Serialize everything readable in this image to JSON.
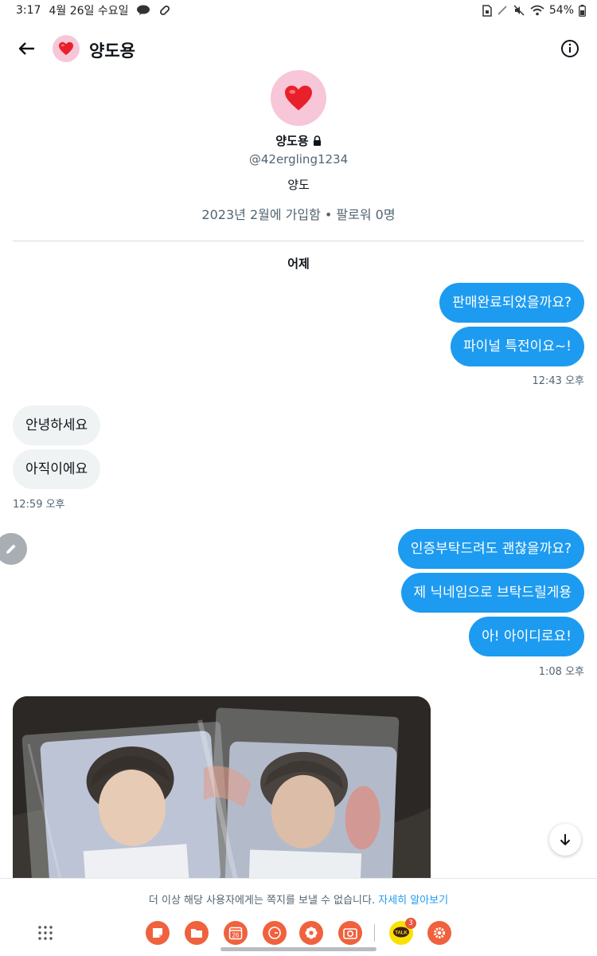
{
  "status_bar": {
    "time": "3:17",
    "date": "4월 26일 수요일",
    "battery": "54%",
    "icons": [
      "talk-icon",
      "pill-icon",
      "sim-icon",
      "no-signal-icon",
      "mute-icon",
      "wifi-icon",
      "battery-icon"
    ]
  },
  "header": {
    "title": "양도용"
  },
  "profile": {
    "name": "양도용",
    "handle": "@42ergling1234",
    "bio": "양도",
    "meta": "2023년 2월에 가입함 • 팔로워 0명"
  },
  "day_label": "어제",
  "messages": [
    {
      "side": "out",
      "text": "판매완료되었을까요?"
    },
    {
      "side": "out",
      "text": "파이널 특전이요~!"
    },
    {
      "side": "in",
      "text": "안녕하세요"
    },
    {
      "side": "in",
      "text": "아직이에요"
    },
    {
      "side": "out",
      "text": "인증부탁드려도 괜찮을까요?"
    },
    {
      "side": "out",
      "text": "제 닉네임으로 브탁드릴게용"
    },
    {
      "side": "out",
      "text": "아! 아이디로요!"
    }
  ],
  "timestamps": [
    "12:43 오후",
    "12:59 오후",
    "1:08 오후"
  ],
  "notice": {
    "text": "더 이상 해당 사용자에게는 쪽지를 보낼 수 없습니다.",
    "link": "자세히 알아보기"
  },
  "taskbar": {
    "apps": [
      "notes-icon",
      "files-icon",
      "calendar-icon",
      "clock-icon",
      "gallery-icon",
      "camera-icon",
      "kakaotalk-icon",
      "settings-icon"
    ],
    "calendar_day": "26",
    "kakao_badge": "3",
    "kakao_label": "TALK",
    "accent": "#f0613d"
  },
  "colors": {
    "accent_blue": "#1d9bf0",
    "incoming_bubble": "#eff3f4",
    "avatar_pink": "#f7c6d9",
    "heart_red": "#e8202a"
  }
}
